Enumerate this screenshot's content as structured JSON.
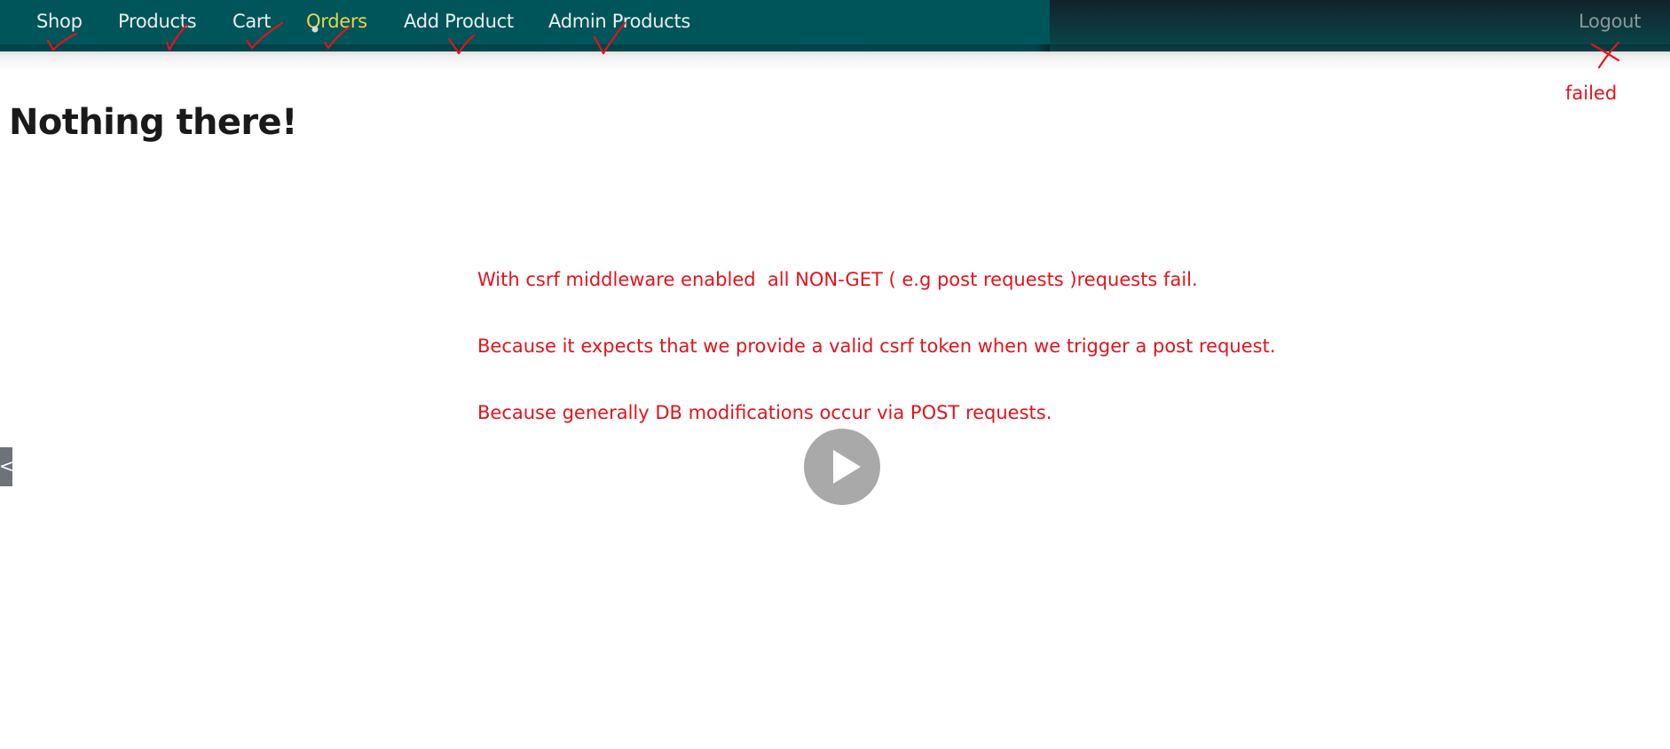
{
  "nav": {
    "items": [
      {
        "label": "Shop",
        "status": "ok"
      },
      {
        "label": "Products",
        "status": "ok"
      },
      {
        "label": "Cart",
        "status": "ok"
      },
      {
        "label": "Orders",
        "status": "ok",
        "active": true
      },
      {
        "label": "Add Product",
        "status": "ok"
      },
      {
        "label": "Admin Products",
        "status": "ok"
      }
    ],
    "logout_label": "Logout",
    "logout_status": "failed"
  },
  "page": {
    "title": "Nothing there!"
  },
  "annotations": {
    "failed_label": "failed",
    "note_lines": [
      "With csrf middleware enabled  all NON-GET ( e.g post requests )requests fail.",
      "Because it expects that we provide a valid csrf token when we trigger a post request.",
      "Because generally DB modifications occur via POST requests."
    ]
  },
  "video": {
    "play_icon": "play-icon",
    "side_tab_glyph": "<"
  },
  "colors": {
    "nav_bg": "#00555a",
    "nav_active": "#e6d64a",
    "annotation_red": "#e3131b",
    "play_button": "#a9a9a9"
  }
}
